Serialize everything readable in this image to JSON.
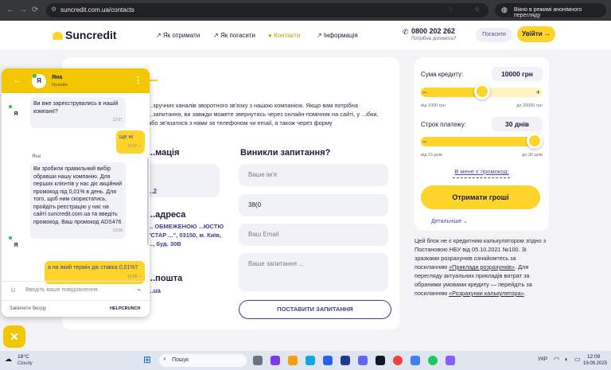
{
  "browser": {
    "url": "suncredit.com.ua/contacts",
    "incognito_label": "Вікно в режимі анонімного перегляду"
  },
  "header": {
    "logo_text": "Suncredit",
    "menu": [
      "Як отримати",
      "Як погасити",
      "Контакти",
      "Інформація"
    ],
    "phone": "0800 202 262",
    "phone_sub": "Потрібна допомога?",
    "repay_label": "Погасити",
    "login_label": "Увійти"
  },
  "main": {
    "intro": "...зручних каналів зворотного зв'язку з нашою компанією. Якщо вам потрібна ...запитання, ви завжди можете звернутись через онлайн-помічник на сайті, у ...ібки, або зв'язатися з нами за телефоном чи email, а також через форму",
    "info_title": "...мація",
    "phone_fragment": "...2",
    "address_title": "...адреса",
    "address_text": "... ОБМЕЖЕНОЮ ...ЮСТЮ \"СТАР ...\", 03150, м. Київ, ..., буд. 30В",
    "mail_title": "...пошта",
    "mail_fragment": "...ua",
    "form_title": "Виникли запитання?",
    "name_placeholder": "Ваше ім'я",
    "phone_placeholder": "38(0",
    "email_placeholder": "Ваш Email",
    "question_placeholder": "Ваше запитання ...",
    "submit_label": "ПОСТАВИТИ ЗАПИТАННЯ"
  },
  "calculator": {
    "amount_label": "Сума кредиту:",
    "amount_value": "10000 грн",
    "amount_min": "від 1000 грн",
    "amount_max": "до 20000 грн",
    "amount_fraction": 0.5,
    "term_label": "Строк платежу:",
    "term_value": "30 днів",
    "term_min": "від 15 днів",
    "term_max": "до 30 днів",
    "term_fraction": 1.0,
    "promo_link": "В мене є промокод:",
    "cta_label": "Отримати гроші",
    "details_label": "Детальніше ⌄"
  },
  "note": {
    "text1": "Цей блок не є кредитним калькулятором згідно з Постановою НБУ від 05.10.2021 №100. Зі зразками розрахунків ознайомтесь за посиланням ",
    "link1": "«Приклади розрахунків»",
    "text2": ". Для перегляду актуальних прикладів витрат за обраними умовами кредиту — перейдіть за посиланням ",
    "link2": "«Розрахунки калькулятора»",
    "text3": "."
  },
  "chat": {
    "avatar_letter": "Я",
    "agent_name": "Яна",
    "status": "Онлайн",
    "messages": [
      {
        "dir": "in",
        "text": "Ви вже зареєструвались в нашій компанії?",
        "time": "12:07"
      },
      {
        "dir": "out",
        "text": "ще ні",
        "time": "12:07"
      },
      {
        "dir": "in",
        "sender": "Яна",
        "text": "Ви зробили правильний вибір обравши нашу компанію. Для перших клієнтів у нас діє акційний промокод під 0,01% в день. Для того, щоб ним скористатись, пройдіть реєстрацію у нас на сайті suncredit.com.ua та введіть промокод. Ваш промокод ADS476",
        "time": "12:08"
      },
      {
        "dir": "out",
        "text": "а на який термін діє ставка 0,01%?",
        "time": "12:09"
      }
    ],
    "input_placeholder": "Введіть ваше повідомлення",
    "end_label": "Закінчити бесіду",
    "brand": "HELPCRUNCH"
  },
  "taskbar": {
    "weather_temp": "18°C",
    "weather_text": "Cloudy",
    "search_placeholder": "Пошук",
    "lang": "УКР",
    "time": "12:09",
    "date": "19.09.2025"
  }
}
